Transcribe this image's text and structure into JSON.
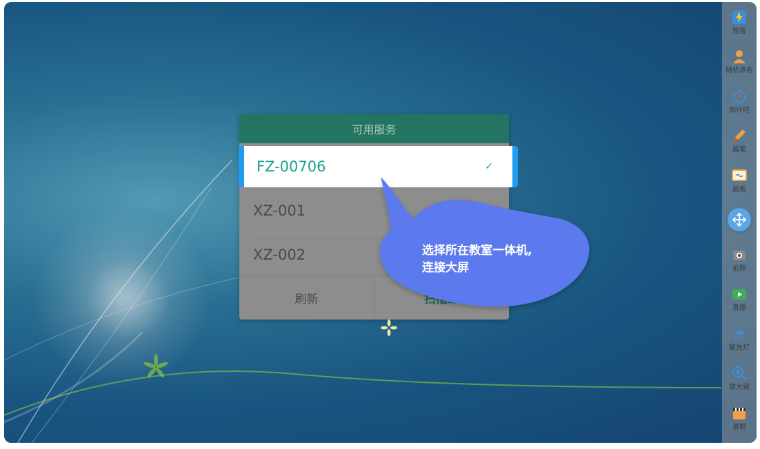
{
  "dialog": {
    "title": "可用服务",
    "selected_service": "FZ-00706",
    "services": [
      "XZ-001",
      "XZ-002"
    ],
    "refresh_label": "刷新",
    "scan_label": "扫描二"
  },
  "tooltip": {
    "line1": "选择所在教室一体机,",
    "line2": "连接大屏"
  },
  "toolbar": {
    "items": [
      {
        "label": "抢答",
        "icon": "lightning-icon"
      },
      {
        "label": "随机点名",
        "icon": "person-icon"
      },
      {
        "label": "倒计时",
        "icon": "timer-icon"
      },
      {
        "label": "画笔",
        "icon": "pencil-icon"
      },
      {
        "label": "画板",
        "icon": "board-icon"
      },
      {
        "label": "",
        "icon": "move-icon"
      },
      {
        "label": "拍照",
        "icon": "camera-icon"
      },
      {
        "label": "直播",
        "icon": "video-icon"
      },
      {
        "label": "聚光灯",
        "icon": "spotlight-icon"
      },
      {
        "label": "放大镜",
        "icon": "magnifier-icon"
      },
      {
        "label": "录制",
        "icon": "clapperboard-icon"
      }
    ]
  },
  "colors": {
    "header": "#237460",
    "accent_teal": "#17a38f",
    "selection_border": "#1d9cf0",
    "bubble": "#5b79ee"
  }
}
